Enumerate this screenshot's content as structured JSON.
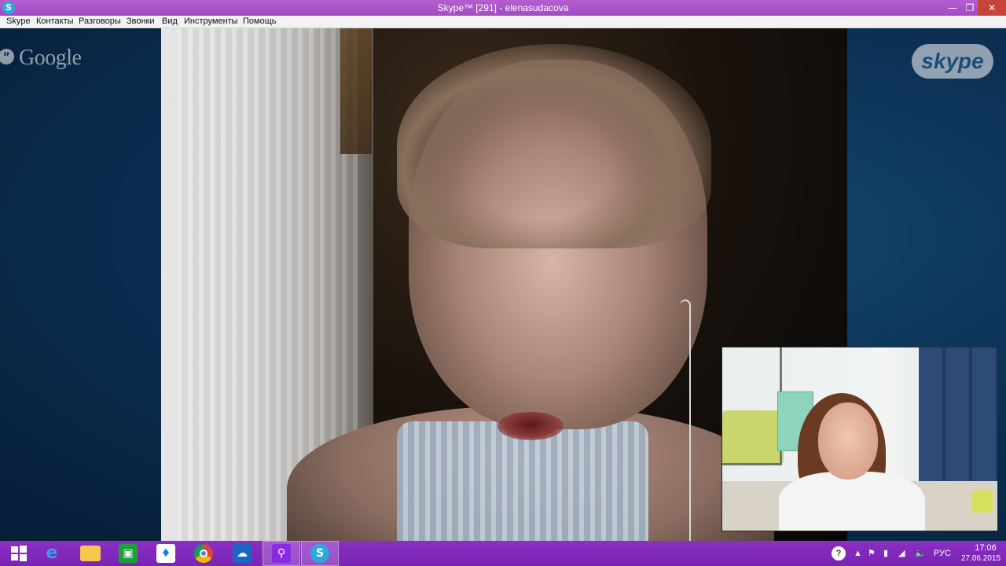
{
  "window": {
    "title": "Skype™ [291] - elenasudacova",
    "app_icon": "skype-icon",
    "controls": [
      "minimize-icon",
      "maximize-icon",
      "close-icon"
    ]
  },
  "menu": {
    "items": [
      "Skype",
      "Контакты",
      "Разговоры",
      "Звонки",
      "Вид",
      "Инструменты",
      "Помощь"
    ]
  },
  "watermarks": {
    "google": "Google",
    "skype": "skype"
  },
  "taskbar": {
    "icons": [
      "windows-start-icon",
      "internet-explorer-icon",
      "file-explorer-icon",
      "store-icon",
      "dropbox-icon",
      "chrome-icon",
      "onedrive-icon",
      "search-app-icon",
      "skype-icon"
    ],
    "tray": {
      "help": "?",
      "language": "РУС",
      "time": "17:06",
      "date": "27.06.2015"
    }
  },
  "colors": {
    "titlebar": "#a34bc2",
    "taskbar": "#7a23b4",
    "stage": "#0b2d50",
    "skype_blue": "#2aa9e0"
  }
}
